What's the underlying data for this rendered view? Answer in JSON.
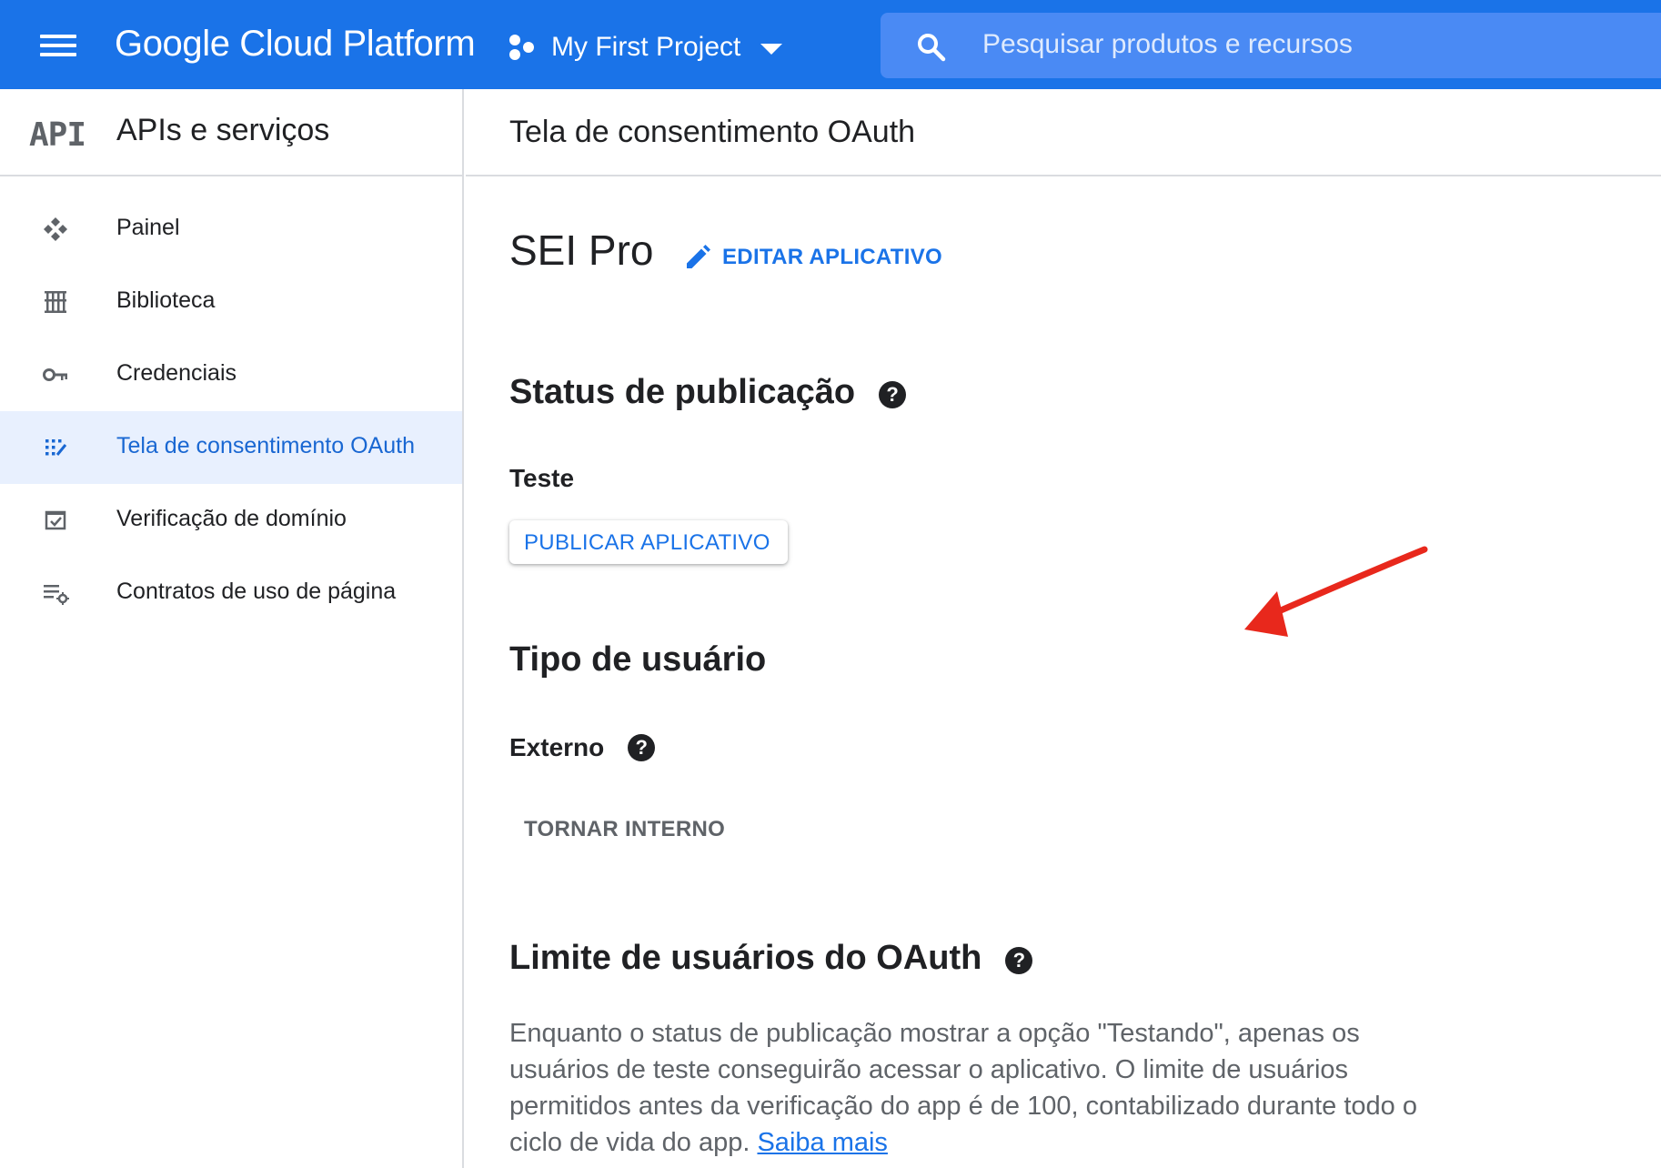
{
  "topbar": {
    "product": "Google Cloud Platform",
    "project": "My First Project",
    "search_placeholder": "Pesquisar produtos e recursos",
    "background": "#1a73e8"
  },
  "sidebar": {
    "logo": "API",
    "title": "APIs e serviços",
    "items": [
      {
        "label": "Painel",
        "icon": "dashboard-icon"
      },
      {
        "label": "Biblioteca",
        "icon": "library-icon"
      },
      {
        "label": "Credenciais",
        "icon": "key-icon"
      },
      {
        "label": "Tela de consentimento OAuth",
        "icon": "consent-screen-icon",
        "active": true
      },
      {
        "label": "Verificação de domínio",
        "icon": "checkbox-icon"
      },
      {
        "label": "Contratos de uso de página",
        "icon": "list-settings-icon"
      }
    ]
  },
  "main": {
    "title": "Tela de consentimento OAuth",
    "app_name": "SEI Pro",
    "edit_label": "EDITAR APLICATIVO",
    "publishing": {
      "heading": "Status de publicação",
      "status": "Teste",
      "publish_label": "PUBLICAR APLICATIVO"
    },
    "user_type": {
      "heading": "Tipo de usuário",
      "value": "Externo",
      "make_internal_label": "TORNAR INTERNO"
    },
    "user_limit": {
      "heading": "Limite de usuários do OAuth",
      "description": "Enquanto o status de publicação mostrar a opção \"Testando\", apenas os usuários de teste conseguirão acessar o aplicativo. O limite de usuários permitidos antes da verificação do app é de 100, contabilizado durante todo o ciclo de vida do app.",
      "learn_more": "Saiba mais"
    },
    "help_glyph": "?"
  },
  "annotation": {
    "color": "#e8281c",
    "icon": "red-arrow-annotation"
  }
}
